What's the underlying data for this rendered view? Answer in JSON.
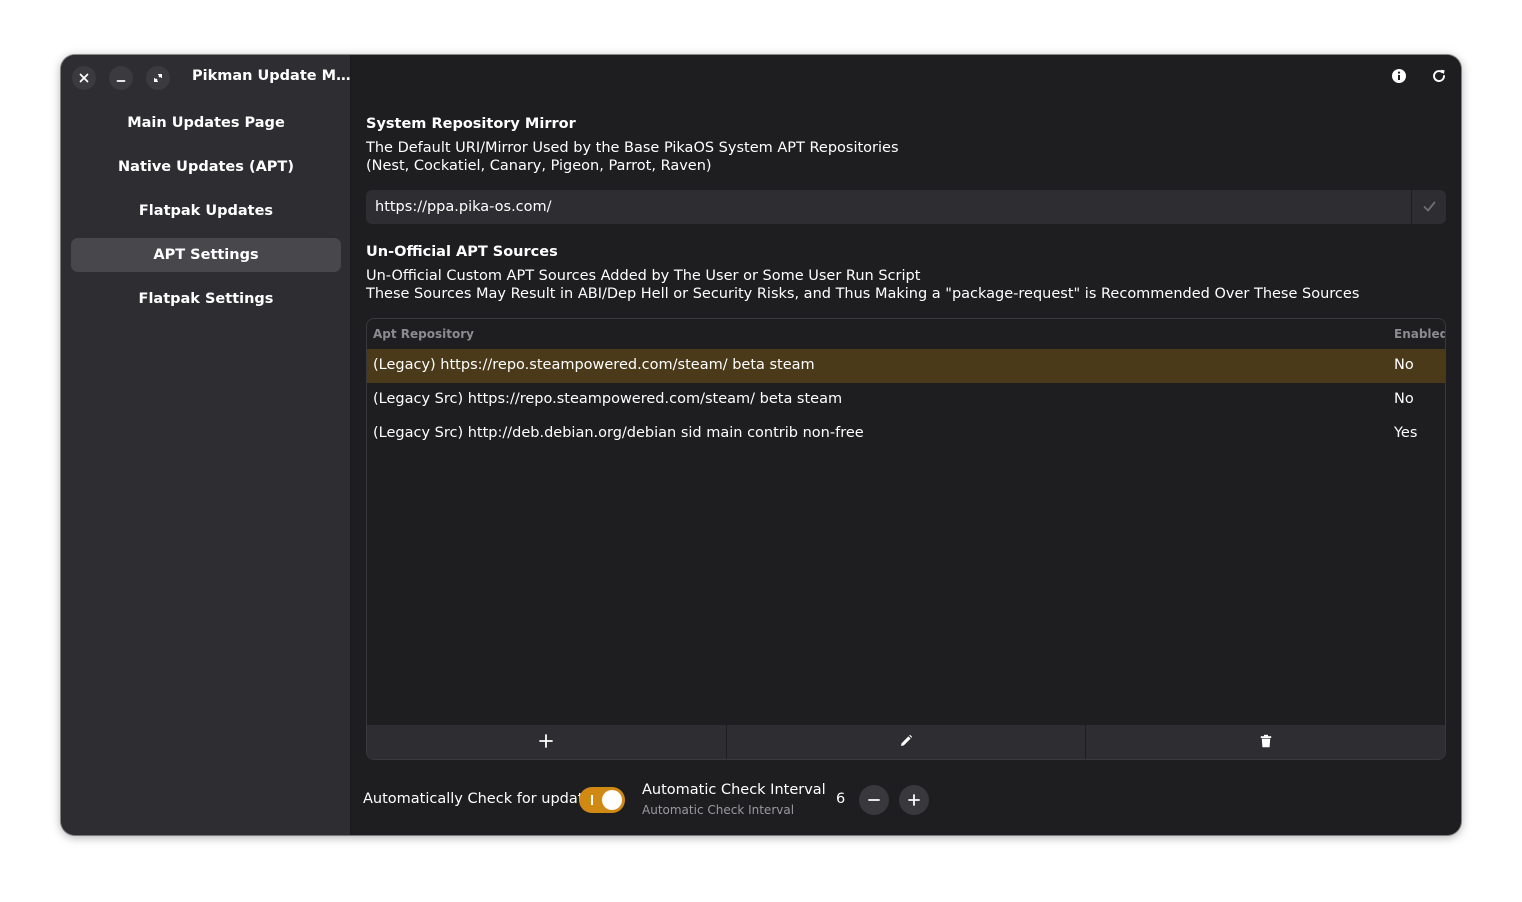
{
  "app": {
    "title": "Pikman Update M…"
  },
  "titlebar": {
    "close_icon": "close-icon",
    "minimize_icon": "minimize-icon",
    "maximize_icon": "maximize-icon"
  },
  "sidebar": {
    "items": [
      {
        "label": "Main Updates Page",
        "selected": false
      },
      {
        "label": "Native Updates (APT)",
        "selected": false
      },
      {
        "label": "Flatpak Updates",
        "selected": false
      },
      {
        "label": "APT Settings",
        "selected": true
      },
      {
        "label": "Flatpak Settings",
        "selected": false
      }
    ]
  },
  "header": {
    "info_icon": "info-icon",
    "refresh_icon": "refresh-icon"
  },
  "mirror": {
    "title": "System Repository Mirror",
    "desc_line1": "The Default URI/Mirror Used by the Base PikaOS System APT Repositories",
    "desc_line2": "(Nest, Cockatiel, Canary, Pigeon, Parrot, Raven)",
    "value": "https://ppa.pika-os.com/",
    "apply_icon": "checkmark-icon"
  },
  "unofficial": {
    "title": "Un-Official APT Sources",
    "desc_line1": "Un-Official Custom APT Sources Added by The User or Some User Run Script",
    "desc_line2": "These Sources May Result in ABI/Dep Hell or Security Risks, and Thus Making a \"package-request\" is Recommended Over These Sources",
    "columns": {
      "repo": "Apt Repository",
      "enabled": "Enabled"
    },
    "rows": [
      {
        "repo": "(Legacy) https://repo.steampowered.com/steam/ beta steam",
        "enabled": "No",
        "selected": true
      },
      {
        "repo": "(Legacy Src) https://repo.steampowered.com/steam/ beta steam",
        "enabled": "No",
        "selected": false
      },
      {
        "repo": "(Legacy Src) http://deb.debian.org/debian sid main contrib non-free",
        "enabled": "Yes",
        "selected": false
      }
    ],
    "toolbar": {
      "add_icon": "plus-icon",
      "edit_icon": "pencil-icon",
      "delete_icon": "trash-icon"
    }
  },
  "auto_check": {
    "label": "Automatically Check for updates",
    "enabled": true
  },
  "interval": {
    "title": "Automatic Check Interval",
    "subtitle": "Automatic Check Interval",
    "value": "6"
  },
  "colors": {
    "accent": "#d08a14",
    "selected_row": "#4b3a1a",
    "sidebar_bg": "#2e2e32",
    "content_bg": "#1e1e21"
  }
}
